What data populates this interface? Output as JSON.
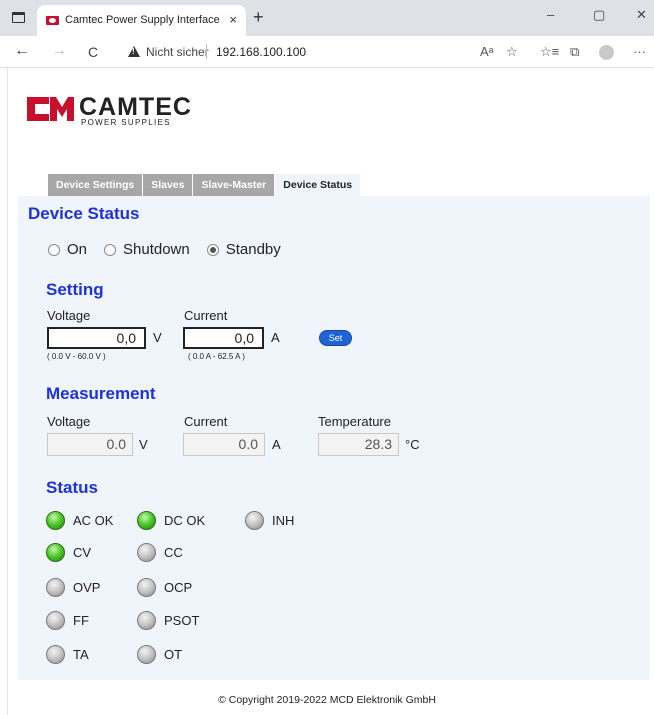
{
  "browser": {
    "tab_title": "Camtec Power Supply Interface",
    "tab_close": "×",
    "new_tab": "+",
    "minimize": "–",
    "maximize": "▢",
    "close": "✕",
    "back": "←",
    "forward": "→",
    "reload": "C",
    "security_label": "Nicht sicher",
    "url": "192.168.100.100",
    "read_aloud": "Aᵃ",
    "fav_add": "☆",
    "favorites": "☆≡",
    "collections": "⧉",
    "menu": "···"
  },
  "logo": {
    "text": "CAMTEC",
    "sub": "POWER SUPPLIES"
  },
  "tabs": [
    "Device Settings",
    "Slaves",
    "Slave-Master",
    "Device Status"
  ],
  "active_tab": "Device Status",
  "title": "Device Status",
  "mode": {
    "options": [
      "On",
      "Shutdown",
      "Standby"
    ],
    "selected": "Standby"
  },
  "setting": {
    "heading": "Setting",
    "voltage_label": "Voltage",
    "voltage_value": "0,0",
    "voltage_unit": "V",
    "voltage_range": "( 0.0 V - 60.0 V )",
    "current_label": "Current",
    "current_value": "0,0",
    "current_unit": "A",
    "current_range": "( 0.0 A - 62.5 A )",
    "set_label": "Set"
  },
  "measurement": {
    "heading": "Measurement",
    "voltage_label": "Voltage",
    "voltage_value": "0.0",
    "voltage_unit": "V",
    "current_label": "Current",
    "current_value": "0.0",
    "current_unit": "A",
    "temperature_label": "Temperature",
    "temperature_value": "28.3",
    "temperature_unit": "°C"
  },
  "status": {
    "heading": "Status",
    "indicators": [
      {
        "label": "AC OK",
        "state": "green"
      },
      {
        "label": "DC OK",
        "state": "green"
      },
      {
        "label": "INH",
        "state": "gray"
      },
      {
        "label": "CV",
        "state": "green"
      },
      {
        "label": "CC",
        "state": "gray"
      },
      {
        "label": "OVP",
        "state": "gray"
      },
      {
        "label": "OCP",
        "state": "gray"
      },
      {
        "label": "FF",
        "state": "gray"
      },
      {
        "label": "PSOT",
        "state": "gray"
      },
      {
        "label": "TA",
        "state": "gray"
      },
      {
        "label": "OT",
        "state": "gray"
      }
    ]
  },
  "copyright": "© Copyright 2019-2022 MCD Elektronik GmbH"
}
